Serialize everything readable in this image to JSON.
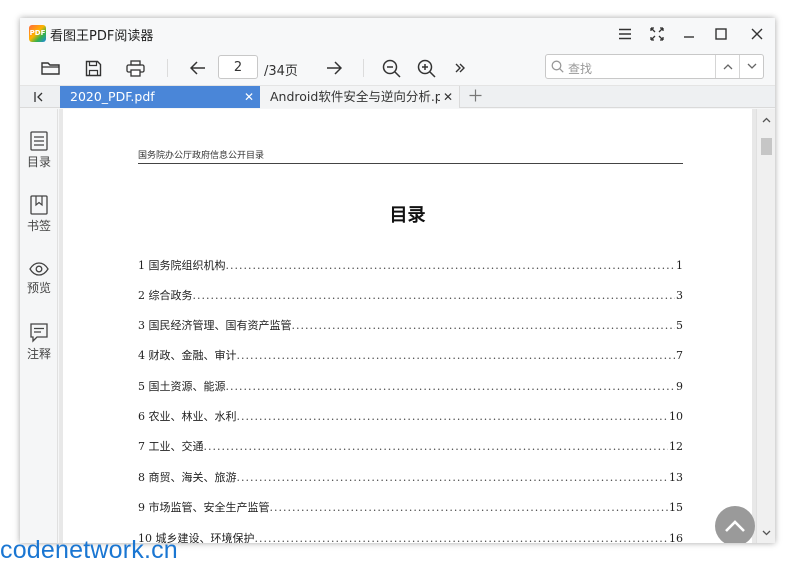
{
  "app": {
    "title": "看图王PDF阅读器",
    "logo_text": "PDF"
  },
  "toolbar": {
    "current_page": "2",
    "total_pages": "/34页",
    "search_placeholder": "查找"
  },
  "tabs": [
    {
      "label": "2020_PDF.pdf",
      "active": true
    },
    {
      "label": "Android软件安全与逆向分析.pdf",
      "active": false
    }
  ],
  "sidebar": {
    "items": [
      {
        "label": "目录",
        "icon": "list-icon"
      },
      {
        "label": "书签",
        "icon": "bookmark-icon"
      },
      {
        "label": "预览",
        "icon": "eye-icon"
      },
      {
        "label": "注释",
        "icon": "comment-icon"
      }
    ]
  },
  "document": {
    "header": "国务院办公厅政府信息公开目录",
    "title": "目录",
    "toc": [
      {
        "num": "1",
        "name": "国务院组织机构",
        "page": "1"
      },
      {
        "num": "2",
        "name": "综合政务",
        "page": "3"
      },
      {
        "num": "3",
        "name": "国民经济管理、国有资产监管",
        "page": "5"
      },
      {
        "num": "4",
        "name": "财政、金融、审计",
        "page": "7"
      },
      {
        "num": "5",
        "name": "国土资源、能源",
        "page": "9"
      },
      {
        "num": "6",
        "name": "农业、林业、水利",
        "page": "10"
      },
      {
        "num": "7",
        "name": "工业、交通",
        "page": "12"
      },
      {
        "num": "8",
        "name": "商贸、海关、旅游",
        "page": "13"
      },
      {
        "num": "9",
        "name": "市场监管、安全生产监管",
        "page": "15"
      },
      {
        "num": "10",
        "name": "城乡建设、环境保护",
        "page": "16"
      }
    ]
  },
  "watermark": "codenetwork.cn",
  "colors": {
    "accent": "#4a86d8",
    "watermark": "#1a76d2"
  }
}
